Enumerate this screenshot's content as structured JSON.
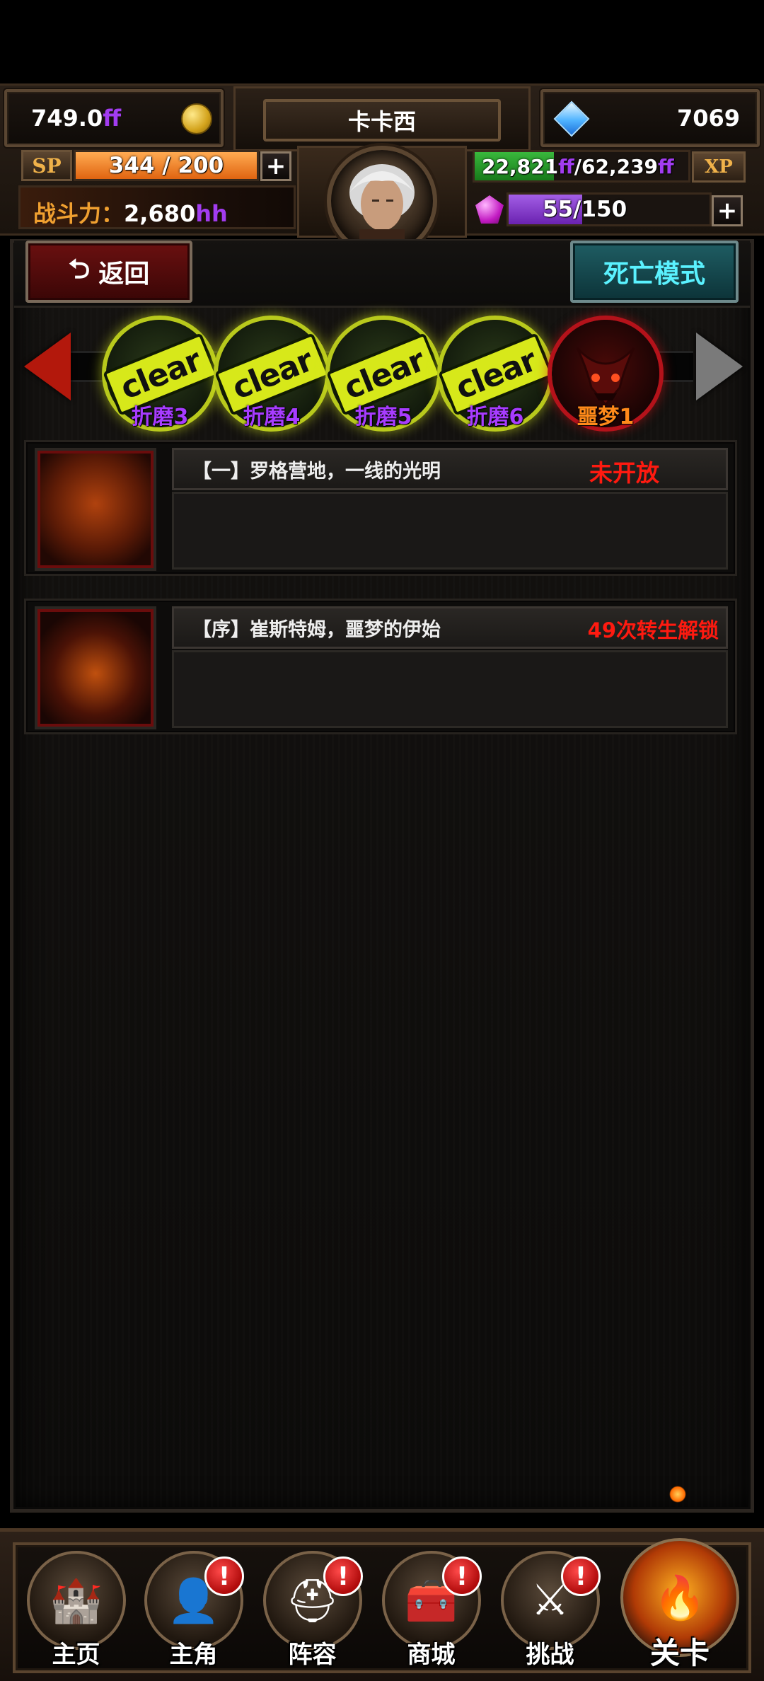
{
  "header": {
    "gold": {
      "value": "749.0",
      "suffix": "ff",
      "icon": "gold-coin-icon"
    },
    "player_name": "卡卡西",
    "diamonds": {
      "value": "7069",
      "icon": "diamond-icon"
    },
    "sp": {
      "tag": "SP",
      "text": "344 / 200",
      "current": 344,
      "max": 200,
      "fill_color": "#f07a1e"
    },
    "xp": {
      "current": "22,821",
      "current_suffix": "ff",
      "separator": "/",
      "max": "62,239",
      "max_suffix": "ff",
      "tag": "XP",
      "fill_fraction": 0.37,
      "fill_color": "#2a9a2a"
    },
    "power": {
      "label": "战斗力：",
      "value": "2,680",
      "suffix": "hh"
    },
    "gems": {
      "text": "55/150",
      "current": 55,
      "max": 150,
      "fill_color": "#8a3ad0",
      "icon": "purple-gem-icon"
    },
    "plus_label": "+"
  },
  "toolbar": {
    "back_label": "返回",
    "death_mode_label": "死亡模式"
  },
  "stages": [
    {
      "badge": "clear",
      "label": "折磨3",
      "cleared": true
    },
    {
      "badge": "clear",
      "label": "折磨4",
      "cleared": true
    },
    {
      "badge": "clear",
      "label": "折磨5",
      "cleared": true
    },
    {
      "badge": "clear",
      "label": "折磨6",
      "cleared": true
    },
    {
      "badge": "",
      "label": "噩梦1",
      "cleared": false,
      "selected": true
    }
  ],
  "chapters": [
    {
      "title": "【一】罗格营地，一线的光明",
      "status": "未开放"
    },
    {
      "title": "【序】崔斯特姆，噩梦的伊始",
      "status": "49次转生解锁"
    }
  ],
  "nav": [
    {
      "label": "主页",
      "icon": "castle-icon",
      "alert": false
    },
    {
      "label": "主角",
      "icon": "hero-icon",
      "alert": true
    },
    {
      "label": "阵容",
      "icon": "helmet-icon",
      "alert": true
    },
    {
      "label": "商城",
      "icon": "treasure-chest-icon",
      "alert": true
    },
    {
      "label": "挑战",
      "icon": "axe-sword-icon",
      "alert": true
    },
    {
      "label": "关卡",
      "icon": "flame-gate-icon",
      "alert": false,
      "active": true
    }
  ],
  "alert_glyph": "!",
  "colors": {
    "purple": "#a73cff",
    "clear_yellow": "#d7e81a",
    "status_red": "#ff1a10",
    "death_cyan": "#5af2ff"
  }
}
